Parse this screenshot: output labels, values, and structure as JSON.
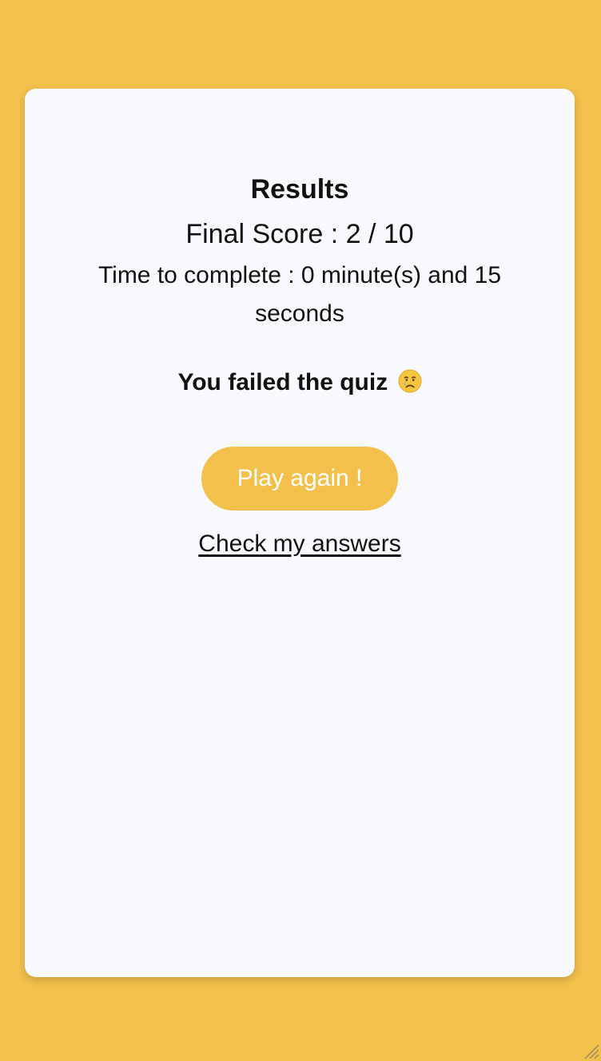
{
  "results": {
    "title": "Results",
    "final_score": "Final Score : 2 / 10",
    "time_to_complete": "Time to complete : 0 minute(s) and 15 seconds",
    "verdict": "You failed the quiz",
    "verdict_icon": "crying-face-icon"
  },
  "actions": {
    "play_again_label": "Play again !",
    "check_answers_label": "Check my answers"
  },
  "colors": {
    "background": "#f3c04c",
    "card": "#f8f9fc",
    "button": "#f3c04c",
    "button_text": "#ffffff"
  }
}
